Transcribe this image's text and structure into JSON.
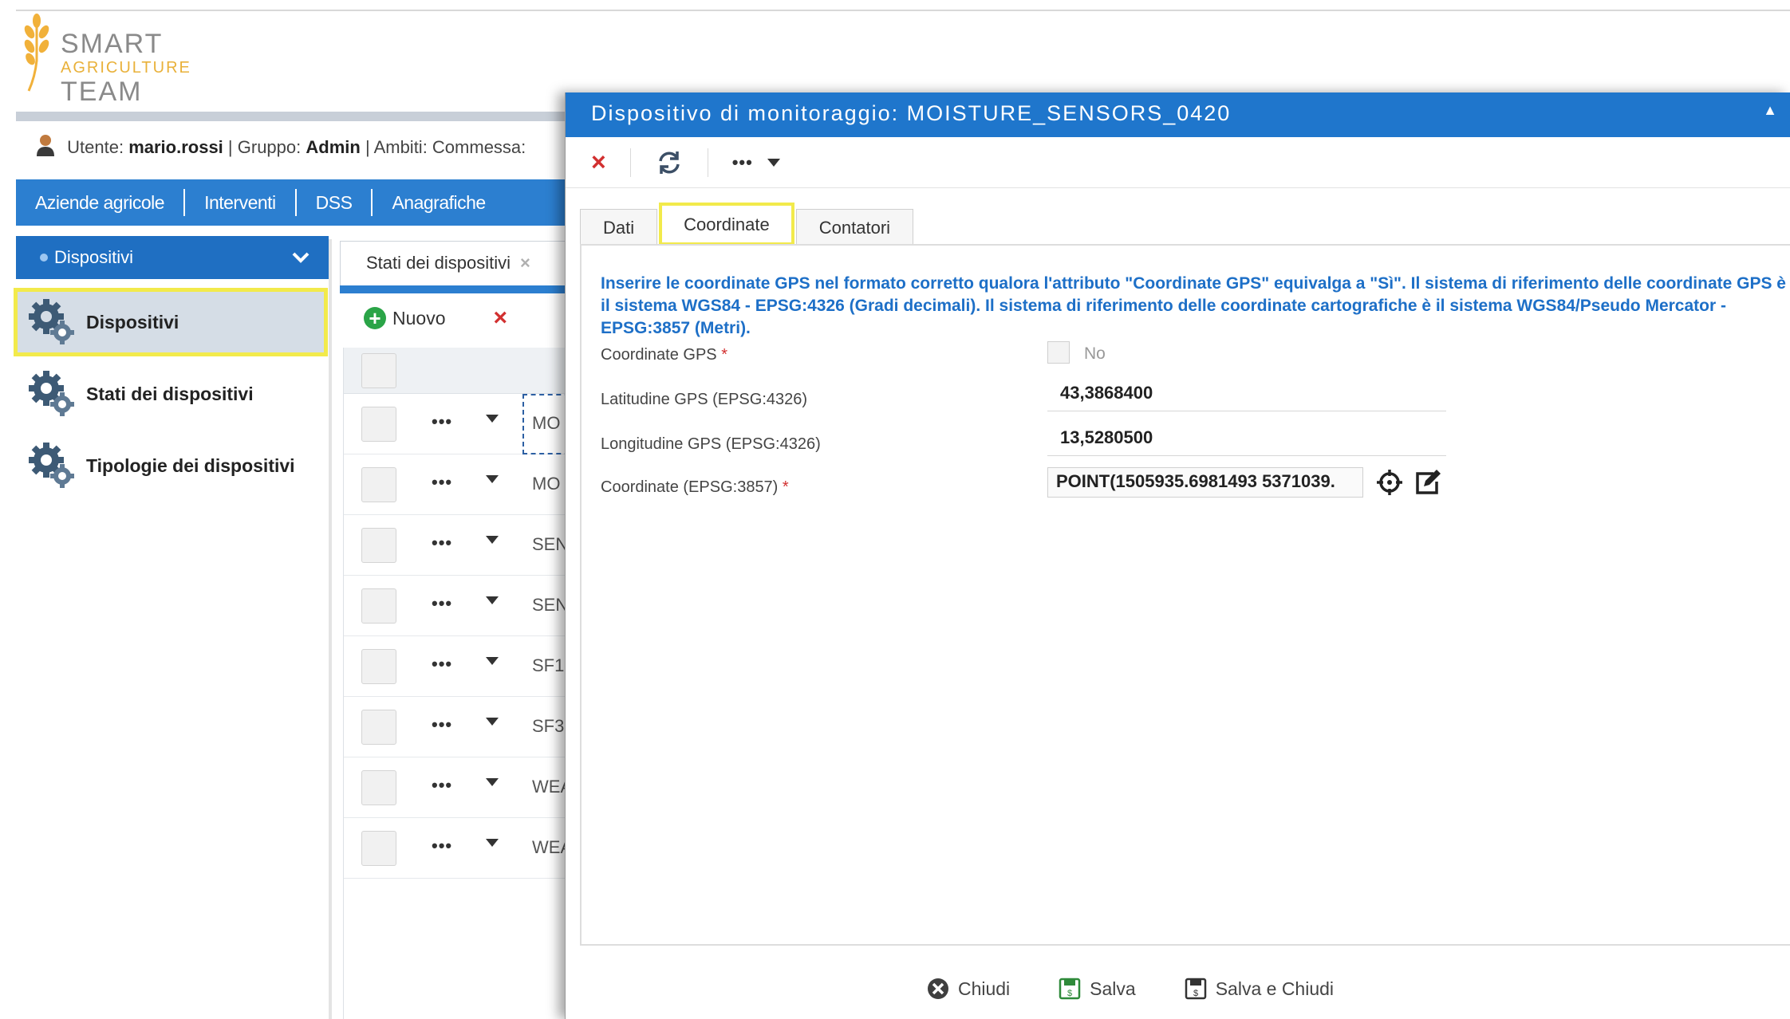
{
  "app": {
    "logo": {
      "line1": "SMART",
      "line2": "AGRICULTURE",
      "line3": "TEAM"
    },
    "user_bar": {
      "user_label": "Utente:",
      "user": "mario.rossi",
      "group_label": "| Gruppo:",
      "group": "Admin",
      "scope": "| Ambiti: Commessa: "
    },
    "menu": [
      "Aziende agricole",
      "Interventi",
      "DSS",
      "Anagrafiche"
    ],
    "sidebar": {
      "section": "Dispositivi",
      "items": [
        {
          "label": "Dispositivi",
          "active": true
        },
        {
          "label": "Stati dei dispositivi",
          "active": false
        },
        {
          "label": "Tipologie dei dispositivi",
          "active": false
        }
      ]
    },
    "doc_tab": {
      "label": "Stati dei dispositivi",
      "close": "×"
    },
    "grid": {
      "new_label": "Nuovo",
      "delete_icon": "×",
      "rows": [
        {
          "code": "MO"
        },
        {
          "code": "MO"
        },
        {
          "code": "SEN"
        },
        {
          "code": "SEN"
        },
        {
          "code": "SF1"
        },
        {
          "code": "SF3"
        },
        {
          "code": "WEA"
        },
        {
          "code": "WEA"
        }
      ],
      "row_menu": "•••"
    }
  },
  "modal": {
    "title": "Dispositivo di monitoraggio: MOISTURE_SENSORS_0420",
    "toolbar": {
      "close": "×",
      "more": "•••"
    },
    "tabs": [
      {
        "label": "Dati",
        "active": false
      },
      {
        "label": "Coordinate",
        "active": true
      },
      {
        "label": "Contatori",
        "active": false
      }
    ],
    "info_text": "Inserire le coordinate GPS nel formato corretto qualora l'attributo \"Coordinate GPS\" equivalga a \"Sì\". Il sistema di riferimento delle coordinate GPS è il sistema WGS84 - EPSG:4326 (Gradi decimali). Il sistema di riferimento delle coordinate cartografiche è il sistema WGS84/Pseudo Mercator - EPSG:3857 (Metri).",
    "fields": {
      "gps_label": "Coordinate GPS",
      "gps_required": "*",
      "gps_value": "No",
      "lat_label": "Latitudine GPS (EPSG:4326)",
      "lat_value": "43,3868400",
      "lon_label": "Longitudine GPS (EPSG:4326)",
      "lon_value": "13,5280500",
      "coord_label": "Coordinate (EPSG:3857)",
      "coord_required": "*",
      "coord_value": "POINT(1505935.6981493 5371039."
    },
    "footer": {
      "close": "Chiudi",
      "save": "Salva",
      "save_close": "Salva e Chiudi"
    }
  },
  "colors": {
    "primary": "#2c7fd0",
    "title_bar": "#1f76cc",
    "highlight": "#f2ea4b",
    "info_text": "#1d6fc7",
    "danger": "#d23030",
    "success": "#2aa447"
  }
}
